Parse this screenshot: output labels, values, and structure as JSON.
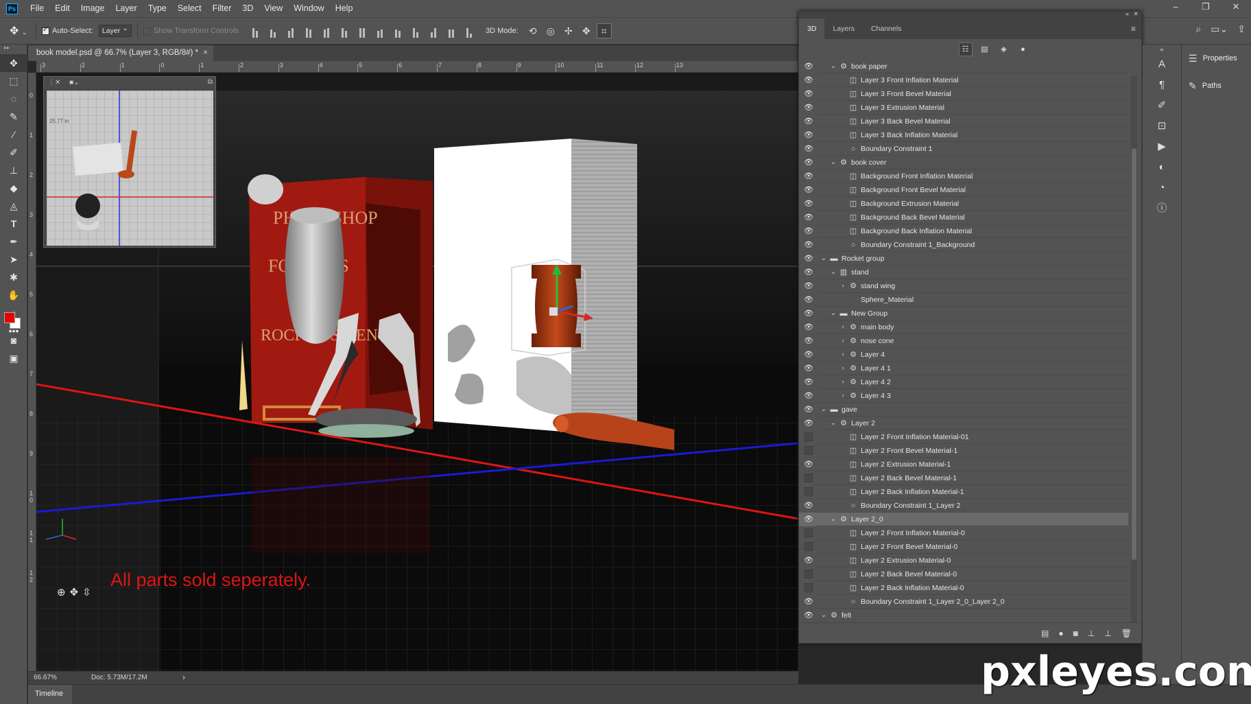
{
  "app": {
    "logo": "Ps",
    "menu": [
      "File",
      "Edit",
      "Image",
      "Layer",
      "Type",
      "Select",
      "Filter",
      "3D",
      "View",
      "Window",
      "Help"
    ],
    "window_controls": [
      "minimize-icon",
      "restore-icon",
      "close-icon"
    ]
  },
  "options": {
    "auto_select_label": "Auto-Select:",
    "auto_select_value": "Layer",
    "show_transform_label": "Show Transform Controls",
    "mode_label": "3D Mode:"
  },
  "document": {
    "tab_title": "book model.psd @ 66.7% (Layer 3, RGB/8#) *",
    "close": "×",
    "caption": "All parts sold seperately.",
    "secondary_view_label": "25.77 in",
    "ruler_top": [
      "3",
      "2",
      "1",
      "0",
      "1",
      "2",
      "3",
      "4",
      "5",
      "6",
      "7",
      "8",
      "9",
      "10",
      "11",
      "12",
      "13"
    ],
    "ruler_left": [
      "0",
      "1",
      "2",
      "3",
      "4",
      "5",
      "6",
      "7",
      "8",
      "9",
      "1 0",
      "1 1",
      "1 2"
    ]
  },
  "status": {
    "zoom": "66.67%",
    "doc": "Doc: 5.73M/17.2M",
    "arrow": "›"
  },
  "timeline": {
    "label": "Timeline"
  },
  "panel": {
    "tabs": [
      "3D",
      "Layers",
      "Channels"
    ],
    "active_tab": "3D",
    "rows": [
      {
        "label": "book paper",
        "level": 1,
        "type": "mesh",
        "expand": "open",
        "visible": true
      },
      {
        "label": "Layer 3 Front Inflation Material",
        "level": 2,
        "type": "material",
        "expand": "none",
        "visible": true
      },
      {
        "label": "Layer 3 Front Bevel Material",
        "level": 2,
        "type": "material",
        "expand": "none",
        "visible": true
      },
      {
        "label": "Layer 3 Extrusion Material",
        "level": 2,
        "type": "material",
        "expand": "none",
        "visible": true
      },
      {
        "label": "Layer 3 Back Bevel Material",
        "level": 2,
        "type": "material",
        "expand": "none",
        "visible": true
      },
      {
        "label": "Layer 3 Back Inflation Material",
        "level": 2,
        "type": "material",
        "expand": "none",
        "visible": true
      },
      {
        "label": "Boundary Constraint 1",
        "level": 2,
        "type": "constraint",
        "expand": "none",
        "visible": true
      },
      {
        "label": "book cover",
        "level": 1,
        "type": "mesh",
        "expand": "open",
        "visible": true
      },
      {
        "label": "Background Front Inflation Material",
        "level": 2,
        "type": "material",
        "expand": "none",
        "visible": true
      },
      {
        "label": "Background Front Bevel Material",
        "level": 2,
        "type": "material",
        "expand": "none",
        "visible": true
      },
      {
        "label": "Background Extrusion Material",
        "level": 2,
        "type": "material",
        "expand": "none",
        "visible": true
      },
      {
        "label": "Background Back Bevel Material",
        "level": 2,
        "type": "material",
        "expand": "none",
        "visible": true
      },
      {
        "label": "Background Back Inflation Material",
        "level": 2,
        "type": "material",
        "expand": "none",
        "visible": true
      },
      {
        "label": "Boundary Constraint 1_Background",
        "level": 2,
        "type": "constraint",
        "expand": "none",
        "visible": true
      },
      {
        "label": "Rocket group",
        "level": 0,
        "type": "folder",
        "expand": "open",
        "visible": true
      },
      {
        "label": "stand",
        "level": 1,
        "type": "mesh-alt",
        "expand": "open",
        "visible": true
      },
      {
        "label": "stand wing",
        "level": 2,
        "type": "mesh",
        "expand": "closed",
        "visible": true
      },
      {
        "label": "Sphere_Material",
        "level": 2,
        "type": "none",
        "expand": "none",
        "visible": true
      },
      {
        "label": "New Group",
        "level": 1,
        "type": "folder",
        "expand": "open",
        "visible": true
      },
      {
        "label": "main body",
        "level": 2,
        "type": "mesh",
        "expand": "closed",
        "visible": true
      },
      {
        "label": "nose cone",
        "level": 2,
        "type": "mesh",
        "expand": "closed",
        "visible": true
      },
      {
        "label": "Layer 4",
        "level": 2,
        "type": "mesh",
        "expand": "closed",
        "visible": true
      },
      {
        "label": "Layer 4 1",
        "level": 2,
        "type": "mesh",
        "expand": "closed",
        "visible": true
      },
      {
        "label": "Layer 4 2",
        "level": 2,
        "type": "mesh",
        "expand": "closed",
        "visible": true
      },
      {
        "label": "Layer 4 3",
        "level": 2,
        "type": "mesh",
        "expand": "closed",
        "visible": true
      },
      {
        "label": "gave",
        "level": 0,
        "type": "folder",
        "expand": "open",
        "visible": true
      },
      {
        "label": "Layer 2",
        "level": 1,
        "type": "mesh",
        "expand": "open",
        "visible": true
      },
      {
        "label": "Layer 2 Front Inflation Material-01",
        "level": 2,
        "type": "material",
        "expand": "none",
        "visible": false
      },
      {
        "label": "Layer 2 Front Bevel Material-1",
        "level": 2,
        "type": "material",
        "expand": "none",
        "visible": false
      },
      {
        "label": "Layer 2 Extrusion Material-1",
        "level": 2,
        "type": "material",
        "expand": "none",
        "visible": true
      },
      {
        "label": "Layer 2 Back Bevel Material-1",
        "level": 2,
        "type": "material",
        "expand": "none",
        "visible": false
      },
      {
        "label": "Layer 2 Back Inflation Material-1",
        "level": 2,
        "type": "material",
        "expand": "none",
        "visible": false
      },
      {
        "label": "Boundary Constraint 1_Layer 2",
        "level": 2,
        "type": "constraint",
        "expand": "none",
        "visible": true
      },
      {
        "label": "Layer 2_0",
        "level": 1,
        "type": "mesh",
        "expand": "open",
        "visible": true,
        "selected": true
      },
      {
        "label": "Layer 2 Front Inflation Material-0",
        "level": 2,
        "type": "material",
        "expand": "none",
        "visible": false
      },
      {
        "label": "Layer 2 Front Bevel Material-0",
        "level": 2,
        "type": "material",
        "expand": "none",
        "visible": false
      },
      {
        "label": "Layer 2 Extrusion Material-0",
        "level": 2,
        "type": "material",
        "expand": "none",
        "visible": true
      },
      {
        "label": "Layer 2 Back Bevel Material-0",
        "level": 2,
        "type": "material",
        "expand": "none",
        "visible": false
      },
      {
        "label": "Layer 2 Back Inflation Material-0",
        "level": 2,
        "type": "material",
        "expand": "none",
        "visible": false
      },
      {
        "label": "Boundary Constraint 1_Layer 2_0_Layer 2_0",
        "level": 2,
        "type": "constraint",
        "expand": "none",
        "visible": true
      },
      {
        "label": "felt",
        "level": 0,
        "type": "mesh",
        "expand": "open",
        "visible": true
      }
    ]
  },
  "dock": {
    "properties_label": "Properties",
    "paths_label": "Paths"
  },
  "watermark": "pxleyes.com",
  "colors": {
    "foreground": "#e60000",
    "background": "#ffffff",
    "axis_x": "#e01414",
    "axis_z": "#1a1ad6",
    "caption": "#e01414"
  }
}
